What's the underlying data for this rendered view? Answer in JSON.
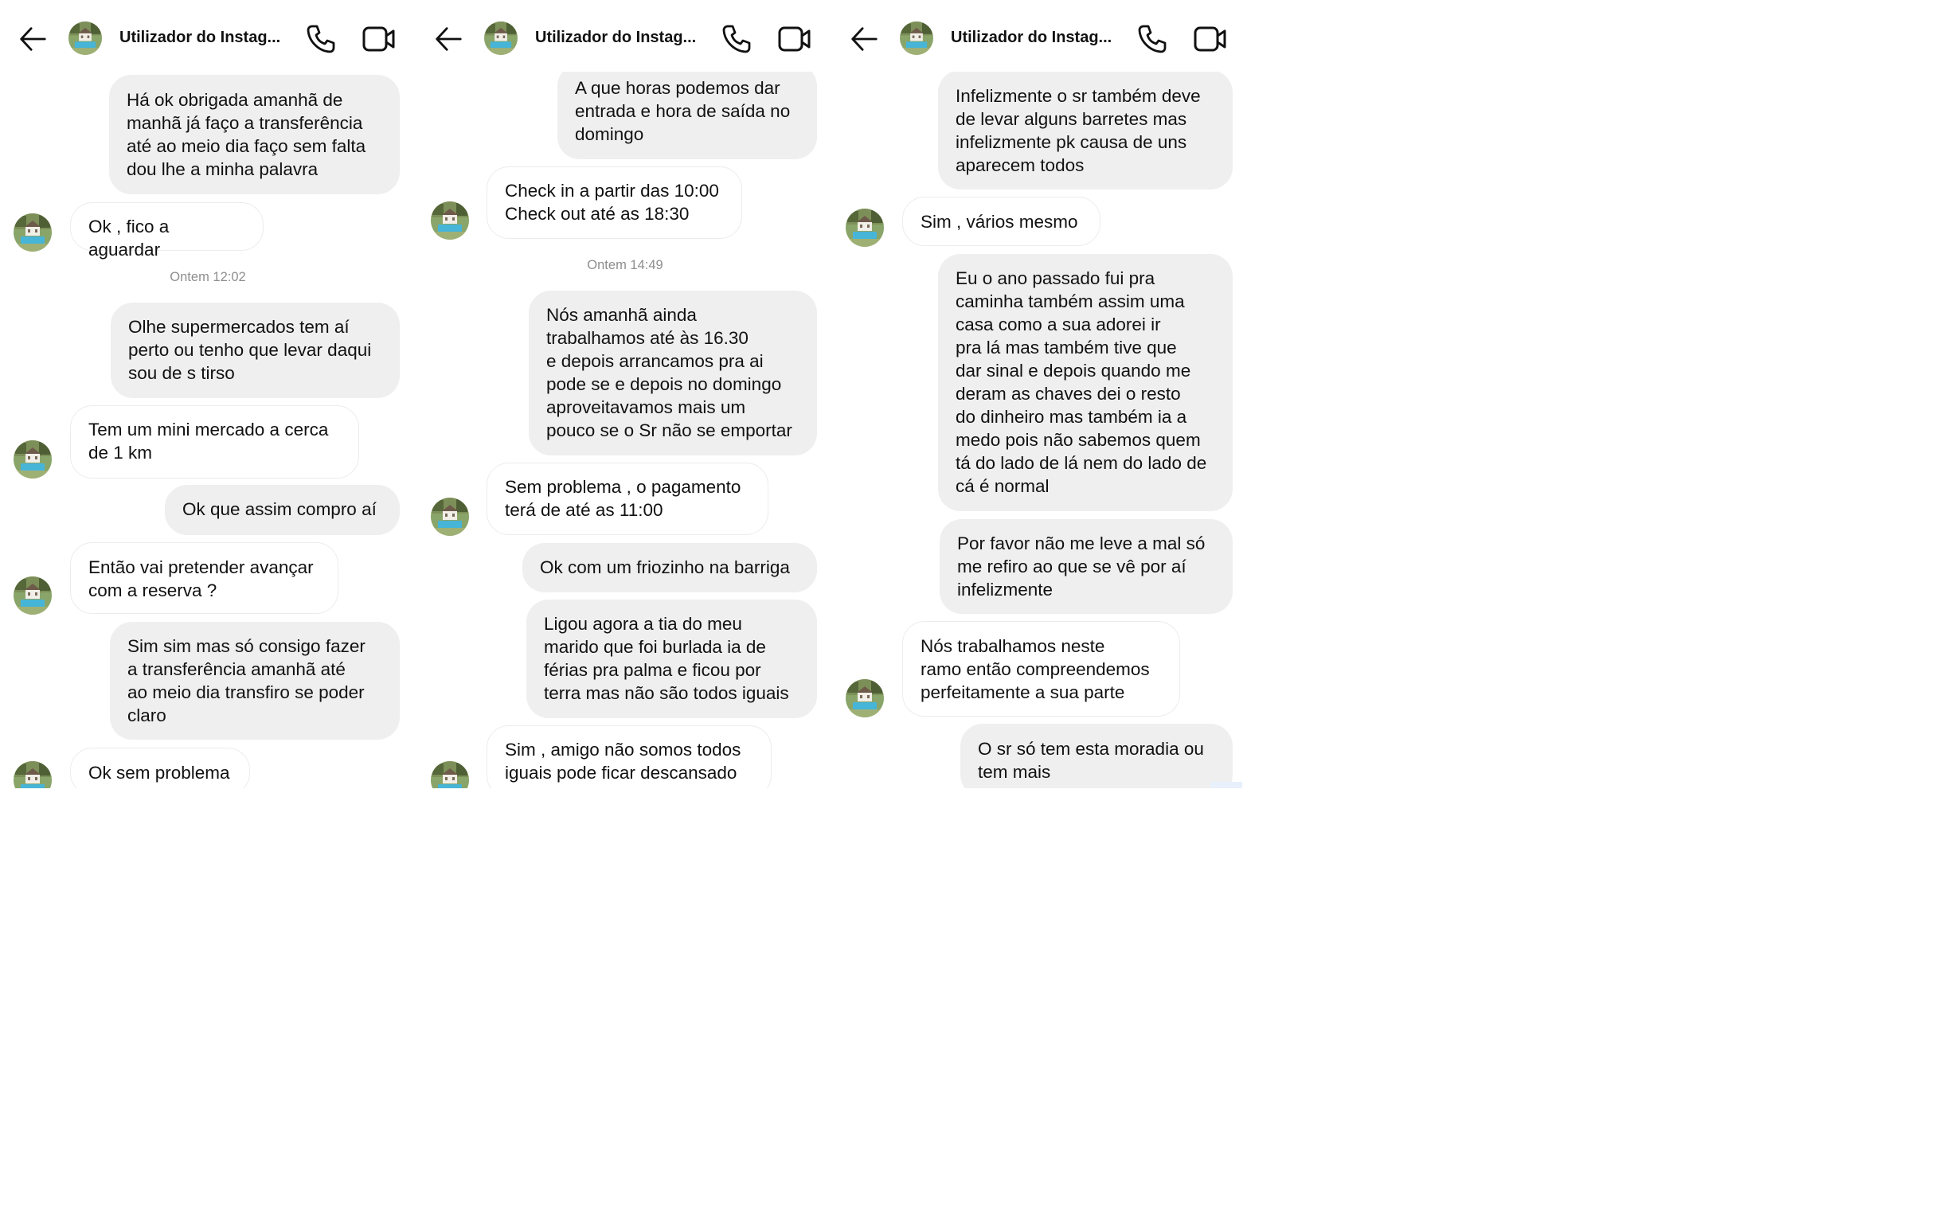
{
  "header": {
    "contact_name": "Utilizador do Instag...",
    "icons": {
      "back": "arrow-left-icon",
      "call": "phone-icon",
      "video": "video-camera-icon"
    }
  },
  "panels": [
    {
      "messages": [
        {
          "type": "out",
          "text": "Há ok obrigada amanhã de\nmanhã já faço a transferência\naté ao meio dia faço sem falta\ndou lhe a minha palavra"
        },
        {
          "type": "in",
          "text": "Ok , fico a aguardar"
        },
        {
          "type": "timestamp",
          "text": "Ontem 12:02"
        },
        {
          "type": "out",
          "text": "Olhe supermercados tem aí\nperto ou tenho que levar daqui\nsou de s tirso"
        },
        {
          "type": "in",
          "text": "Tem um mini mercado a cerca\nde 1 km"
        },
        {
          "type": "out",
          "text": "Ok que assim compro aí"
        },
        {
          "type": "in",
          "text": "Então vai pretender avançar\ncom a reserva ?"
        },
        {
          "type": "out",
          "text": "Sim sim mas só consigo fazer\na transferência amanhã até\nao meio dia transfiro se poder\nclaro"
        },
        {
          "type": "in",
          "text": "Ok sem problema"
        }
      ]
    },
    {
      "messages": [
        {
          "type": "out",
          "text": "A que horas podemos dar\nentrada e hora de saída no\ndomingo"
        },
        {
          "type": "in",
          "text": "Check in a partir das 10:00\nCheck out até as 18:30"
        },
        {
          "type": "timestamp",
          "text": "Ontem 14:49"
        },
        {
          "type": "out",
          "text": "Nós amanhã ainda\ntrabalhamos até às 16.30\ne depois arrancamos pra ai\npode se  e depois no domingo\naproveitavamos mais um\npouco se o Sr não se emportar"
        },
        {
          "type": "in",
          "text": "Sem problema , o pagamento\nterá de até as 11:00"
        },
        {
          "type": "out",
          "text": "Ok com um friozinho na barriga"
        },
        {
          "type": "out",
          "text": "Ligou agora a tia do meu\nmarido que foi burlada ia de\nférias pra palma e ficou por\nterra mas não são todos iguais"
        },
        {
          "type": "in",
          "text": "Sim , amigo não somos todos\niguais pode ficar descansado"
        }
      ]
    },
    {
      "messages": [
        {
          "type": "out",
          "text": "Infelizmente o sr também deve\nde levar alguns barretes  mas\ninfelizmente pk causa de uns\naparecem todos"
        },
        {
          "type": "in",
          "text": "Sim , vários mesmo"
        },
        {
          "type": "out",
          "text": "Eu o ano passado fui pra\ncaminha também assim uma\ncasa como a sua adorei ir\npra lá mas também tive que\ndar sinal e depois quando me\nderam as chaves dei o resto\ndo dinheiro mas também ia a\nmedo pois não sabemos quem\ntá do lado de lá nem do lado de\ncá é normal"
        },
        {
          "type": "out",
          "text": "Por favor não me leve a mal só\nme refiro ao que se vê por aí\ninfelizmente"
        },
        {
          "type": "in",
          "text": "Nós trabalhamos neste\nramo então compreendemos\nperfeitamente a sua parte"
        },
        {
          "type": "out",
          "text": "O sr só tem esta moradia ou\ntem mais"
        }
      ]
    }
  ]
}
